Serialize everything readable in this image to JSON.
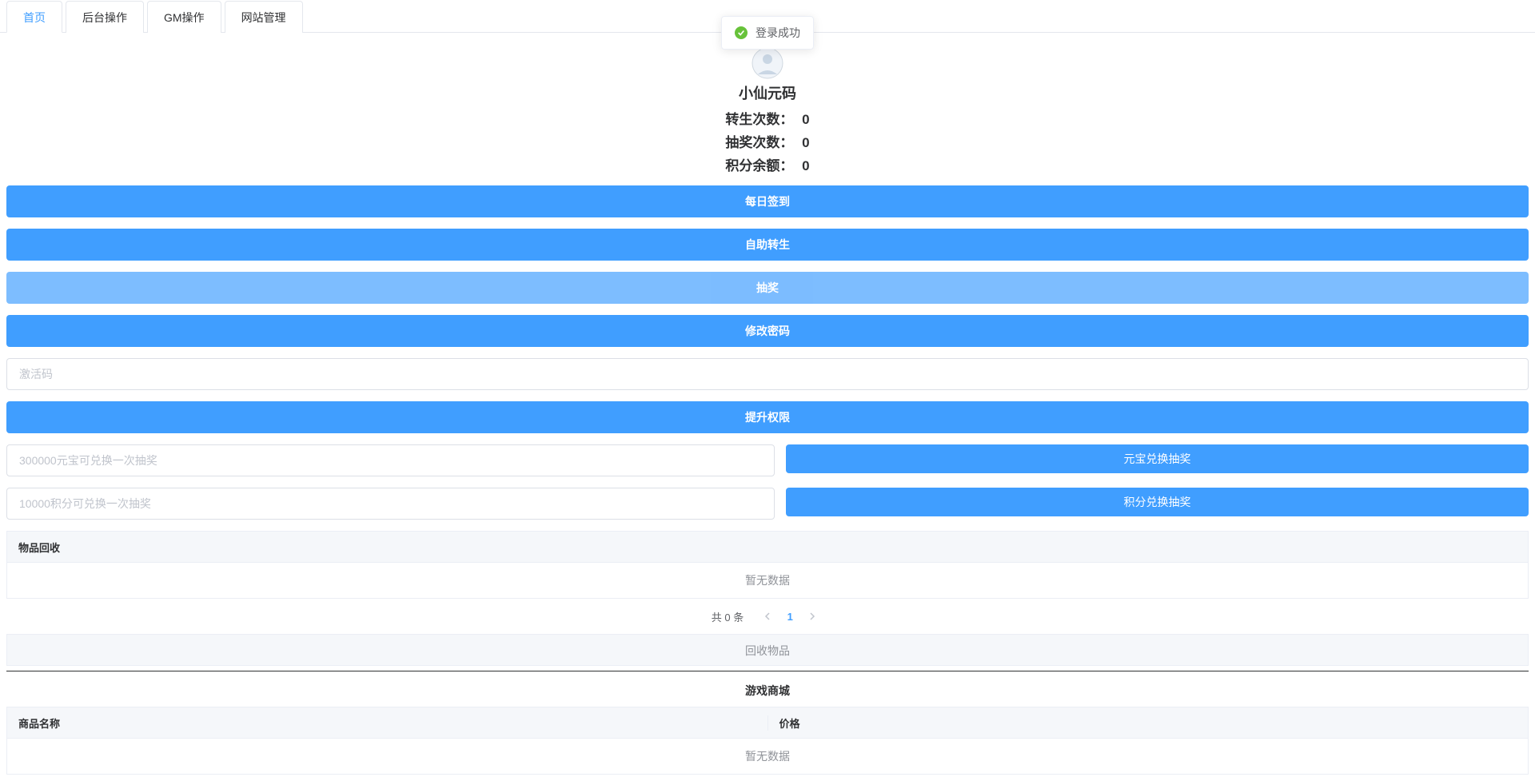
{
  "toast": {
    "message": "登录成功"
  },
  "tabs": {
    "items": [
      "首页",
      "后台操作",
      "GM操作",
      "网站管理"
    ],
    "activeIndex": 0
  },
  "profile": {
    "username": "小仙元码",
    "stats": [
      {
        "label": "转生次数：",
        "value": "0"
      },
      {
        "label": "抽奖次数：",
        "value": "0"
      },
      {
        "label": "积分余额：",
        "value": "0"
      }
    ]
  },
  "buttons": {
    "daily_sign": "每日签到",
    "self_rebirth": "自助转生",
    "lottery": "抽奖",
    "change_password": "修改密码",
    "upgrade_permission": "提升权限",
    "yuanbao_exchange": "元宝兑换抽奖",
    "points_exchange": "积分兑换抽奖"
  },
  "inputs": {
    "activation_code_placeholder": "激活码",
    "yuanbao_placeholder": "300000元宝可兑换一次抽奖",
    "points_placeholder": "10000积分可兑换一次抽奖"
  },
  "recycling": {
    "header": "物品回收",
    "empty_text": "暂无数据",
    "pagination_total": "共 0 条",
    "page_current": "1",
    "recycle_button": "回收物品"
  },
  "shop": {
    "title": "游戏商城",
    "col_name": "商品名称",
    "col_price": "价格",
    "empty_text": "暂无数据"
  }
}
